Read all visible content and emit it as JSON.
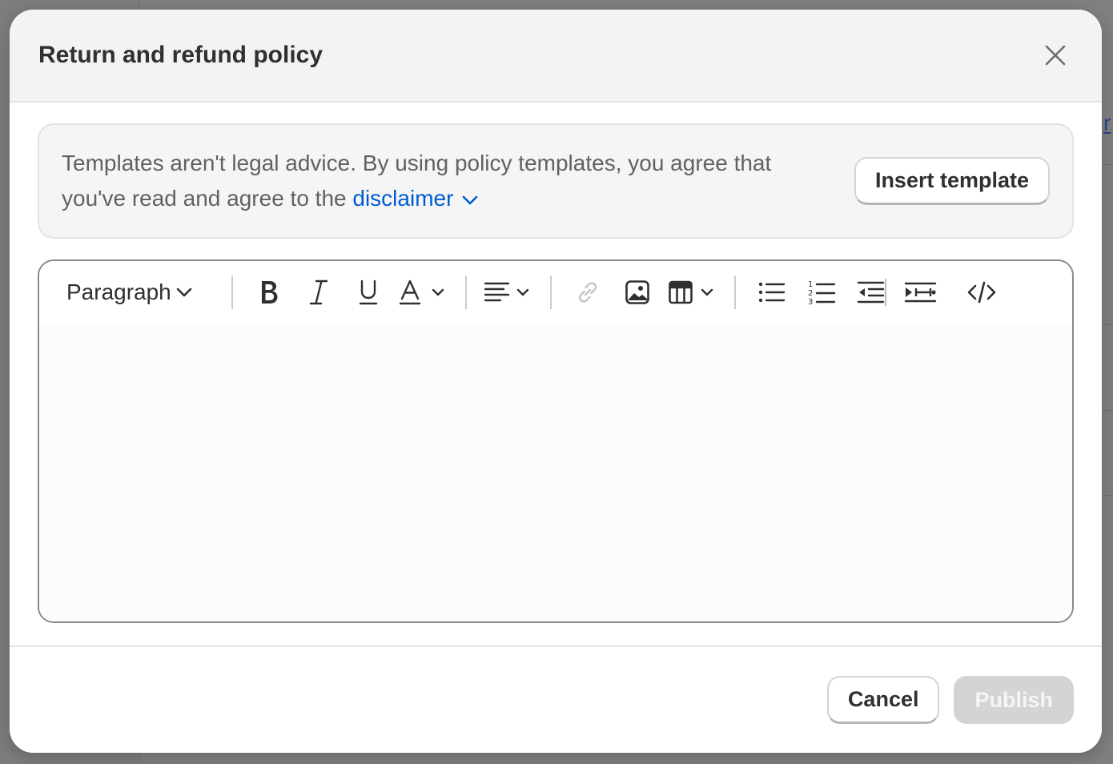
{
  "background": {
    "link_fragment": "r"
  },
  "modal": {
    "title": "Return and refund policy",
    "close_icon": "close-icon"
  },
  "banner": {
    "text_part1": "Templates aren't legal advice. By using policy templates, you agree that you've read and agree to the ",
    "link_text": "disclaimer",
    "insert_button_label": "Insert template"
  },
  "toolbar": {
    "format_select_value": "Paragraph",
    "icons": [
      "bold-icon",
      "italic-icon",
      "underline-icon",
      "text-color-icon",
      "align-icon",
      "link-icon",
      "image-icon",
      "table-icon",
      "bullet-list-icon",
      "numbered-list-icon",
      "outdent-icon",
      "indent-icon",
      "code-view-icon"
    ]
  },
  "editor": {
    "content": ""
  },
  "footer": {
    "cancel_label": "Cancel",
    "publish_label": "Publish"
  },
  "colors": {
    "link": "#005bd3",
    "primary_disabled": "#d4d4d4",
    "text": "#303030"
  }
}
